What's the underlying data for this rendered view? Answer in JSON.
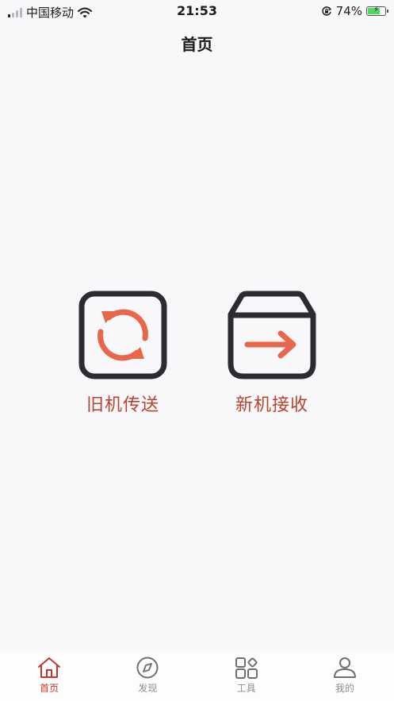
{
  "status_bar": {
    "carrier": "中国移动",
    "time": "21:53",
    "battery_percent": "74%",
    "battery_level": 0.74,
    "signal_bars_active": 1,
    "signal_bars_total": 4,
    "icons": [
      "signal-icon",
      "wifi-icon",
      "orientation-lock-icon",
      "battery-icon"
    ]
  },
  "nav": {
    "title": "首页"
  },
  "actions": [
    {
      "label": "旧机传送",
      "icon": "sync-arrows-icon"
    },
    {
      "label": "新机接收",
      "icon": "box-arrow-icon"
    }
  ],
  "tabs": [
    {
      "label": "首页",
      "icon": "home-icon",
      "active": true
    },
    {
      "label": "发现",
      "icon": "compass-icon",
      "active": false
    },
    {
      "label": "工具",
      "icon": "tools-grid-icon",
      "active": false
    },
    {
      "label": "我的",
      "icon": "user-icon",
      "active": false
    }
  ],
  "colors": {
    "accent": "#e8674a",
    "label": "#b8432e",
    "active_tab": "#c0392b",
    "inactive_tab": "#8e8e93",
    "icon_frame": "#2c2c30"
  }
}
